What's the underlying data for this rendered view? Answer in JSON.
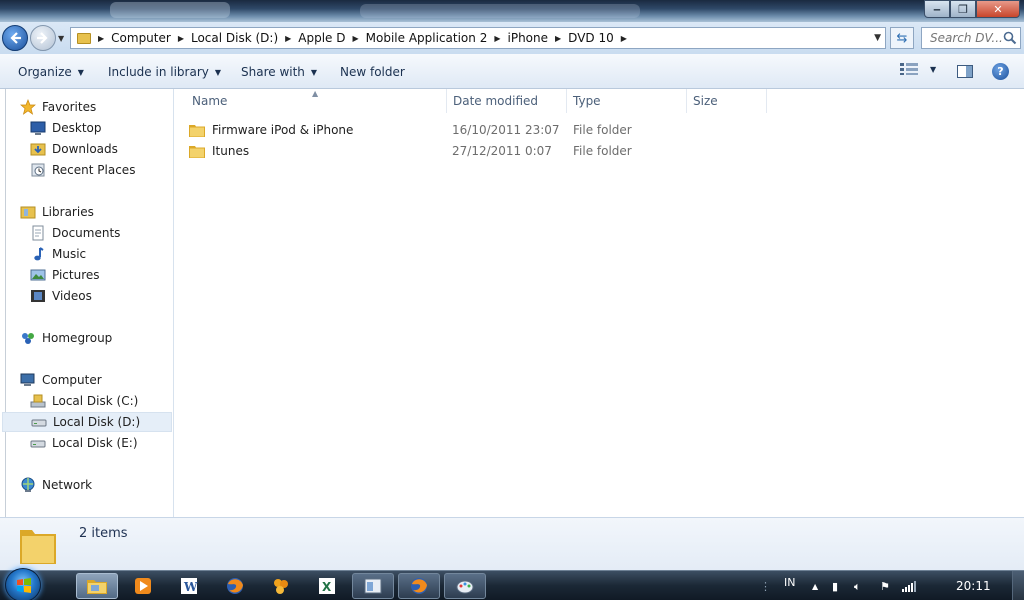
{
  "window": {
    "controls": {
      "minimize": "‒",
      "maximize": "❐",
      "close": "✕"
    }
  },
  "address_bar": {
    "breadcrumbs": [
      "Computer",
      "Local Disk (D:)",
      "Apple D",
      "Mobile Application 2",
      "iPhone",
      "DVD 10"
    ]
  },
  "search": {
    "placeholder": "Search DV..."
  },
  "toolbar": {
    "organize": "Organize",
    "include_in_library": "Include in library",
    "share_with": "Share with",
    "new_folder": "New folder"
  },
  "nav_pane": {
    "favorites": {
      "label": "Favorites",
      "items": [
        "Desktop",
        "Downloads",
        "Recent Places"
      ]
    },
    "libraries": {
      "label": "Libraries",
      "items": [
        "Documents",
        "Music",
        "Pictures",
        "Videos"
      ]
    },
    "homegroup": {
      "label": "Homegroup"
    },
    "computer": {
      "label": "Computer",
      "items": [
        "Local Disk (C:)",
        "Local Disk (D:)",
        "Local Disk (E:)"
      ],
      "selected": "Local Disk (D:)"
    },
    "network": {
      "label": "Network"
    }
  },
  "file_list": {
    "columns": [
      "Name",
      "Date modified",
      "Type",
      "Size"
    ],
    "rows": [
      {
        "name": "Firmware iPod & iPhone",
        "date": "16/10/2011 23:07",
        "type": "File folder"
      },
      {
        "name": "Itunes",
        "date": "27/12/2011 0:07",
        "type": "File folder"
      }
    ]
  },
  "details": {
    "count": "2 items"
  },
  "taskbar": {
    "apps": [
      "windows-explorer",
      "media-player",
      "word",
      "firefox",
      "app-orange",
      "excel",
      "window-switcher",
      "firefox",
      "paint"
    ],
    "tray": {
      "language": "IN",
      "time": "20:11"
    }
  },
  "colors": {
    "accent": "#1b4f9a",
    "folder": "#e7c14e",
    "taskbar": "#1b2836"
  }
}
